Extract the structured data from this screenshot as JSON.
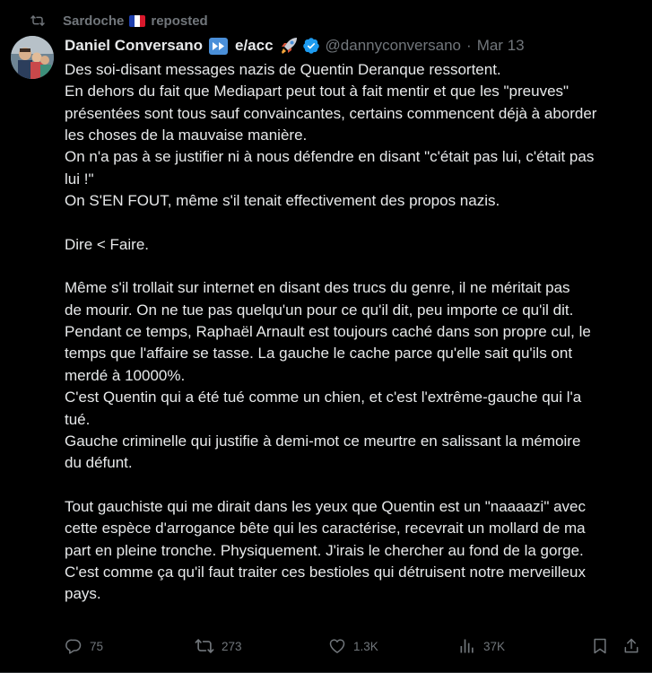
{
  "repost": {
    "user": "Sardoche",
    "label": "reposted"
  },
  "author": {
    "display_name": "Daniel Conversano",
    "bio_tag": "e/acc",
    "handle": "@dannyconversano",
    "separator": "·",
    "date": "Mar 13"
  },
  "tweet": {
    "lines": [
      "Des soi-disant messages nazis de Quentin Deranque ressortent.",
      "En dehors du fait que Mediapart peut tout à fait mentir et que les \"preuves\"",
      "présentées sont tous sauf convaincantes, certains commencent déjà à aborder",
      "les choses de la mauvaise manière.",
      "On n'a pas à se justifier ni à nous défendre en disant \"c'était pas lui, c'était pas",
      "lui !\"",
      "On S'EN FOUT, même s'il tenait effectivement des propos nazis.",
      "",
      "Dire < Faire.",
      "",
      "Même s'il trollait sur internet en disant des trucs du genre, il ne méritait pas",
      "de mourir. On ne tue pas quelqu'un pour ce qu'il dit, peu importe ce qu'il dit.",
      "Pendant ce temps, Raphaël Arnault est toujours caché dans son propre cul, le",
      "temps que l'affaire se tasse. La gauche le cache parce qu'elle sait qu'ils ont",
      "merdé à 10000%.",
      "C'est Quentin qui a été tué comme un chien, et c'est l'extrême-gauche qui l'a",
      "tué.",
      "Gauche criminelle qui justifie à demi-mot ce meurtre en salissant la mémoire",
      "du défunt.",
      "",
      "Tout gauchiste qui me dirait dans les yeux que Quentin est un \"naaaazi\" avec",
      "cette espèce d'arrogance bête qui les caractérise, recevrait un mollard de ma",
      "part en pleine tronche. Physiquement. J'irais le chercher au fond de la gorge.",
      "C'est comme ça qu'il faut traiter ces bestioles qui détruisent notre merveilleux",
      "pays."
    ]
  },
  "actions": {
    "replies": "75",
    "reposts": "273",
    "likes": "1.3K",
    "views": "37K"
  },
  "colors": {
    "background": "#000000",
    "text": "#e7e9ea",
    "muted": "#71767b",
    "verified": "#1d9bf0",
    "badge": "#4a8fd9"
  },
  "icons": {
    "repost_header": "repost-icon",
    "flag": "france-flag-icon",
    "badge": "fast-forward-icon",
    "rocket": "rocket-icon",
    "verified": "verified-badge-icon",
    "reply": "reply-icon",
    "repost": "repost-icon",
    "like": "heart-icon",
    "views": "views-icon",
    "bookmark": "bookmark-icon",
    "share": "share-icon"
  }
}
